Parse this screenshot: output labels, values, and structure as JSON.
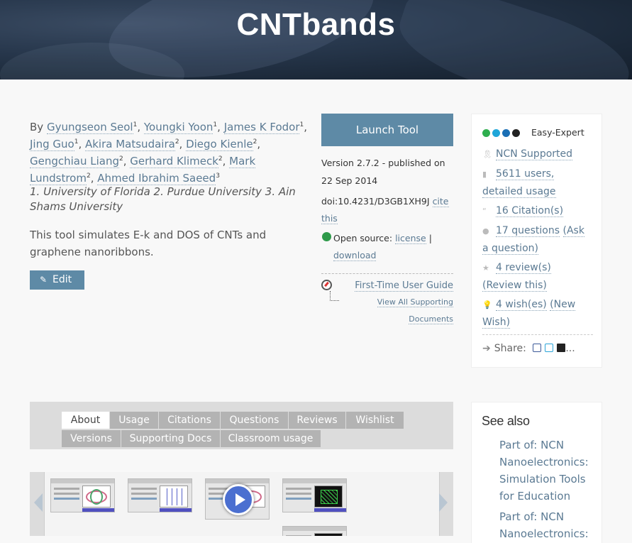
{
  "hero": {
    "title": "CNTbands"
  },
  "tool": {
    "by": "By",
    "authors": [
      {
        "name": "Gyungseon Seol",
        "sup": "1"
      },
      {
        "name": "Youngki Yoon",
        "sup": "1"
      },
      {
        "name": "James K Fodor",
        "sup": "1"
      },
      {
        "name": "Jing Guo",
        "sup": "1"
      },
      {
        "name": "Akira Matsudaira",
        "sup": "2"
      },
      {
        "name": "Diego Kienle",
        "sup": "2"
      },
      {
        "name": "Gengchiau Liang",
        "sup": "2"
      },
      {
        "name": "Gerhard Klimeck",
        "sup": "2"
      },
      {
        "name": "Mark Lundstrom",
        "sup": "2"
      },
      {
        "name": "Ahmed Ibrahim Saeed",
        "sup": "3"
      }
    ],
    "affiliations": "1. University of Florida 2. Purdue University 3. Ain Shams University",
    "description": "This tool simulates E-k and DOS of CNTs and graphene nanoribbons.",
    "edit_label": "Edit"
  },
  "launch": {
    "label": "Launch Tool",
    "version": "Version 2.7.2 - published on 22 Sep 2014",
    "doi": "doi:10.4231/D3GB1XH9J",
    "cite": "cite this",
    "open_source_label": "Open source:",
    "license": "license",
    "separator": "|",
    "download": "download",
    "guide": "First-Time User Guide",
    "supporting": "View All Supporting Documents"
  },
  "sidebar": {
    "level_colors": [
      "#2eae4e",
      "#1fa6d9",
      "#1a6fb5",
      "#222222"
    ],
    "level": "Easy-Expert",
    "items": [
      {
        "icon": "ribbon-icon",
        "text": "NCN Supported",
        "extra": ""
      },
      {
        "icon": "chart-icon",
        "text": "5611 users, detailed usage",
        "extra": ""
      },
      {
        "icon": "quote-icon",
        "text": "16 Citation(s)",
        "extra": ""
      },
      {
        "icon": "chat-icon",
        "text": "17 questions",
        "extra": "(Ask a question)"
      },
      {
        "icon": "star-icon",
        "text": "4 review(s)",
        "extra": "(Review this)"
      },
      {
        "icon": "bulb-icon",
        "text": "4 wish(es)",
        "extra": "(New Wish)"
      }
    ],
    "share_label": "Share:",
    "share_more": "..."
  },
  "tabs": [
    {
      "label": "About",
      "active": true
    },
    {
      "label": "Usage"
    },
    {
      "label": "Citations"
    },
    {
      "label": "Questions"
    },
    {
      "label": "Reviews"
    },
    {
      "label": "Wishlist"
    },
    {
      "label": "Versions"
    },
    {
      "label": "Supporting Docs"
    },
    {
      "label": "Classroom usage"
    }
  ],
  "see_also": {
    "title": "See also",
    "items": [
      "Part of: NCN Nanoelectronics: Simulation Tools for Education",
      "Part of: NCN Nanoelectronics:"
    ]
  }
}
